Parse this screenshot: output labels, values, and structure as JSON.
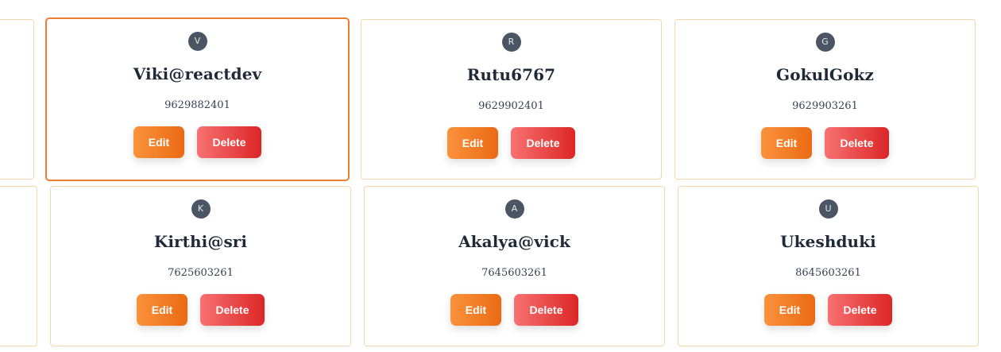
{
  "buttons": {
    "edit_label": "Edit",
    "delete_label": "Delete"
  },
  "colors": {
    "card_border": "#f6d6ad",
    "active_border": "#ec7d33",
    "avatar_bg": "#4b5563",
    "edit_gradient": [
      "#fb923c",
      "#ea6a14"
    ],
    "delete_gradient": [
      "#f87171",
      "#dc2626"
    ]
  },
  "users": [
    {
      "initial": "V",
      "name": "Viki@reactdev",
      "phone": "9629882401",
      "selected": true
    },
    {
      "initial": "R",
      "name": "Rutu6767",
      "phone": "9629902401"
    },
    {
      "initial": "G",
      "name": "GokulGokz",
      "phone": "9629903261"
    },
    {
      "initial": "K",
      "name": "Kirthi@sri",
      "phone": "7625603261"
    },
    {
      "initial": "A",
      "name": "Akalya@vick",
      "phone": "7645603261"
    },
    {
      "initial": "U",
      "name": "Ukeshduki",
      "phone": "8645603261"
    }
  ]
}
